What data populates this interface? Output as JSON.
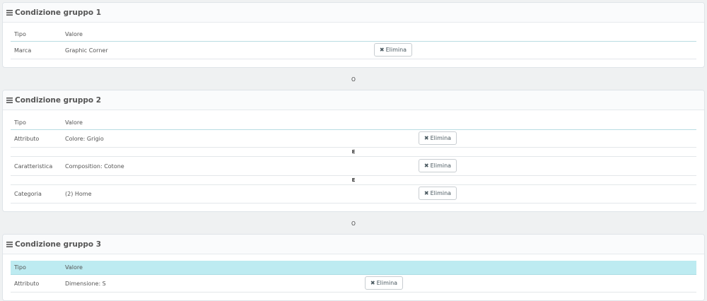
{
  "groups": [
    {
      "title": "Condizione gruppo 1",
      "headers": {
        "tipo": "Tipo",
        "valore": "Valore"
      },
      "rows": [
        {
          "tipo": "Marca",
          "valore": "Graphic Corner",
          "button": "Elimina"
        }
      ]
    },
    {
      "title": "Condizione gruppo 2",
      "headers": {
        "tipo": "Tipo",
        "valore": "Valore"
      },
      "rows": [
        {
          "tipo": "Attributo",
          "valore": "Colore: Grigio",
          "button": "Elimina"
        },
        {
          "tipo": "Caratteristica",
          "valore": "Composition: Cotone",
          "button": "Elimina"
        },
        {
          "tipo": "Categoria",
          "valore": "(2) Home",
          "button": "Elimina"
        }
      ],
      "and_label": "E"
    },
    {
      "title": "Condizione gruppo 3",
      "headers": {
        "tipo": "Tipo",
        "valore": "Valore"
      },
      "rows": [
        {
          "tipo": "Attributo",
          "valore": "Dimensione: S",
          "button": "Elimina"
        }
      ]
    }
  ],
  "or_label": "O",
  "icons": {
    "heading": "list-icon",
    "button": "close-icon"
  },
  "colors": {
    "highlight_header": "#bdebf1",
    "background": "#eff1f2"
  }
}
